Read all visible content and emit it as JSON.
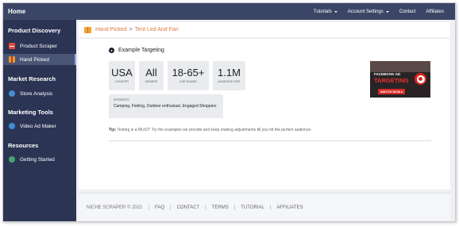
{
  "navbar": {
    "brand": "Home",
    "links": [
      {
        "label": "Tutorials",
        "dropdown": true
      },
      {
        "label": "Account Settings",
        "dropdown": true
      },
      {
        "label": "Contact",
        "dropdown": false
      },
      {
        "label": "Affiliates",
        "dropdown": false
      }
    ]
  },
  "sidebar": {
    "sections": [
      {
        "title": "Product Discovery",
        "items": [
          {
            "label": "Product Scraper",
            "icon": "envelope-icon"
          },
          {
            "label": "Hand Picked",
            "icon": "gift-icon",
            "active": true
          }
        ]
      },
      {
        "title": "Market Research",
        "items": [
          {
            "label": "Store Analysis",
            "icon": "globe-icon"
          }
        ]
      },
      {
        "title": "Marketing Tools",
        "items": [
          {
            "label": "Video Ad Maker",
            "icon": "video-icon"
          }
        ]
      },
      {
        "title": "Resources",
        "items": [
          {
            "label": "Getting Started",
            "icon": "compass-icon"
          }
        ]
      }
    ]
  },
  "breadcrumb": {
    "root": "Hand Picked",
    "separator": ">",
    "current": "Tent Led And Fan"
  },
  "targeting": {
    "title": "Example Targeting",
    "cards": [
      {
        "value": "USA",
        "label": "COUNTRY"
      },
      {
        "value": "All",
        "label": "GENDER"
      },
      {
        "value": "18-65+",
        "label": "AGE RANGE"
      },
      {
        "value": "1.1M",
        "label": "AUDIENCE SIZE"
      }
    ],
    "interests": {
      "label": "INTERESTS",
      "value": "Camping, Fishing, Outdoor enthusiast, Engaged Shoppers"
    },
    "tip_label": "Tip:",
    "tip_text": "Testing is a MUST! Try the examples we provide and keep making adjustments till you hit the perfect audience."
  },
  "ad_banner": {
    "line1": "FACEBOOK AD",
    "line2": "TARGETING",
    "button": "WATCH NOW ▸"
  },
  "footer": {
    "copyright": "NICHE SCRAPER © 2021",
    "links": [
      "FAQ",
      "CONTACT",
      "TERMS",
      "TUTORIAL",
      "AFFILIATES"
    ]
  },
  "colors": {
    "navbar": "#3b4667",
    "sidebar": "#2c3454",
    "accent": "#e07a3a",
    "ad_red": "#e8322e"
  }
}
